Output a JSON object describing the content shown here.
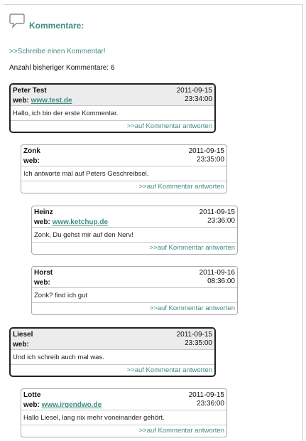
{
  "header": {
    "icon": "speech-bubble-icon",
    "title": "Kommentare:"
  },
  "write_comment_link": ">>Schreibe einen Kommentar!",
  "comment_count": "Anzahl bisheriger Kommentare: 6",
  "reply_label": ">>auf Kommentar antworten",
  "web_label": "web:",
  "colors": {
    "accent": "#3f8d84",
    "top_level_header_bg": "#ececec"
  },
  "comments": [
    {
      "author": "Peter Test",
      "web": "www.test.de",
      "date": "2011-09-15",
      "time": "23:34:00",
      "text": "Hallo, ich bin der erste Kommentar.",
      "level": 0
    },
    {
      "author": "Zonk",
      "web": "",
      "date": "2011-09-15",
      "time": "23:35:00",
      "text": "Ich antworte mal auf Peters Geschreibsel.",
      "level": 1
    },
    {
      "author": "Heinz",
      "web": "www.ketchup.de",
      "date": "2011-09-15",
      "time": "23:36:00",
      "text": "Zonk, Du gehst mir auf den Nerv!",
      "level": 2
    },
    {
      "author": "Horst",
      "web": "",
      "date": "2011-09-16",
      "time": "08:36:00",
      "text": "Zonk? find ich gut",
      "level": 2
    },
    {
      "author": "Liesel",
      "web": "",
      "date": "2011-09-15",
      "time": "23:35:00",
      "text": "Und ich schreib auch mal was.",
      "level": 0
    },
    {
      "author": "Lotte",
      "web": "www.irgendwo.de",
      "date": "2011-09-15",
      "time": "23:36:00",
      "text": "Hallo Liesel, lang nix mehr voneinander gehört.",
      "level": 1
    }
  ]
}
